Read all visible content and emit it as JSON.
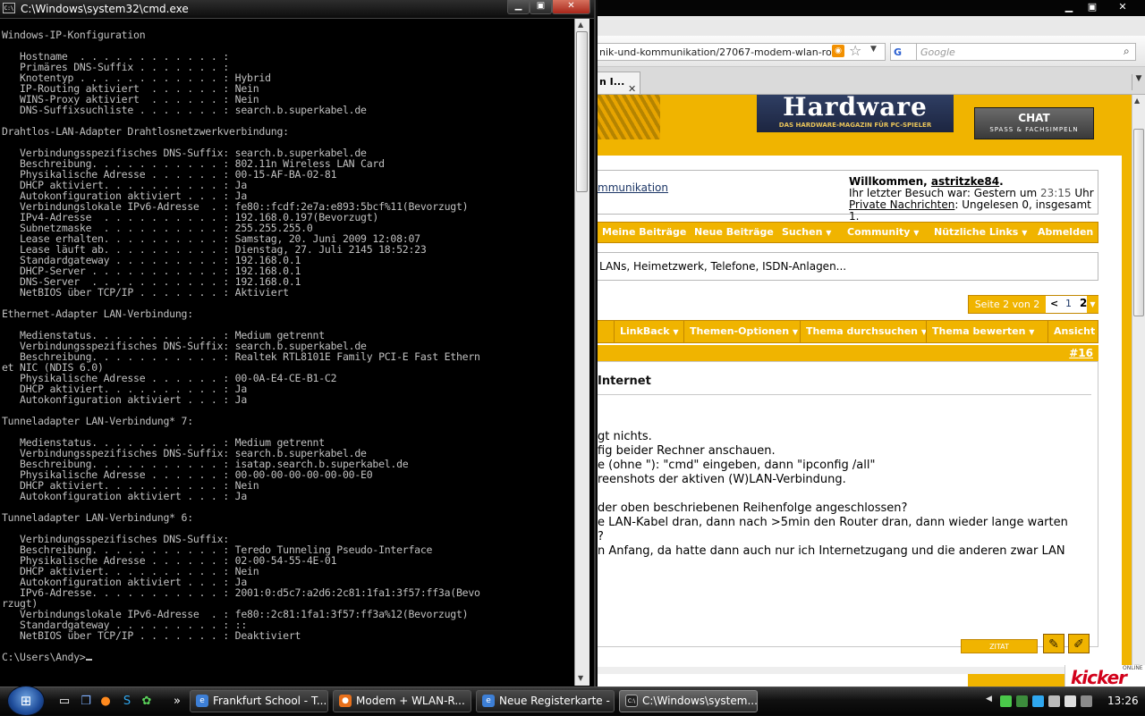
{
  "cmd": {
    "title": "C:\\Windows\\system32\\cmd.exe",
    "icon_text": "C:\\",
    "controls": {
      "minimize": "▁",
      "maximize": "▣",
      "close": "✕"
    },
    "output": [
      "Windows-IP-Konfiguration",
      "",
      "   Hostname  . . . . . . . . . . . . : ",
      "   Primäres DNS-Suffix . . . . . . . : ",
      "   Knotentyp . . . . . . . . . . . . : Hybrid",
      "   IP-Routing aktiviert  . . . . . . : Nein",
      "   WINS-Proxy aktiviert  . . . . . . : Nein",
      "   DNS-Suffixsuchliste . . . . . . . : search.b.superkabel.de",
      "",
      "Drahtlos-LAN-Adapter Drahtlosnetzwerkverbindung:",
      "",
      "   Verbindungsspezifisches DNS-Suffix: search.b.superkabel.de",
      "   Beschreibung. . . . . . . . . . . : 802.11n Wireless LAN Card",
      "   Physikalische Adresse . . . . . . : 00-15-AF-BA-02-81",
      "   DHCP aktiviert. . . . . . . . . . : Ja",
      "   Autokonfiguration aktiviert . . . : Ja",
      "   Verbindungslokale IPv6-Adresse  . : fe80::fcdf:2e7a:e893:5bcf%11(Bevorzugt)",
      "   IPv4-Adresse  . . . . . . . . . . : 192.168.0.197(Bevorzugt)",
      "   Subnetzmaske  . . . . . . . . . . : 255.255.255.0",
      "   Lease erhalten. . . . . . . . . . : Samstag, 20. Juni 2009 12:08:07",
      "   Lease läuft ab. . . . . . . . . . : Dienstag, 27. Juli 2145 18:52:23",
      "   Standardgateway . . . . . . . . . : 192.168.0.1",
      "   DHCP-Server . . . . . . . . . . . : 192.168.0.1",
      "   DNS-Server  . . . . . . . . . . . : 192.168.0.1",
      "   NetBIOS über TCP/IP . . . . . . . : Aktiviert",
      "",
      "Ethernet-Adapter LAN-Verbindung:",
      "",
      "   Medienstatus. . . . . . . . . . . : Medium getrennt",
      "   Verbindungsspezifisches DNS-Suffix: search.b.superkabel.de",
      "   Beschreibung. . . . . . . . . . . : Realtek RTL8101E Family PCI-E Fast Ethern",
      "et NIC (NDIS 6.0)",
      "   Physikalische Adresse . . . . . . : 00-0A-E4-CE-B1-C2",
      "   DHCP aktiviert. . . . . . . . . . : Ja",
      "   Autokonfiguration aktiviert . . . : Ja",
      "",
      "Tunneladapter LAN-Verbindung* 7:",
      "",
      "   Medienstatus. . . . . . . . . . . : Medium getrennt",
      "   Verbindungsspezifisches DNS-Suffix: search.b.superkabel.de",
      "   Beschreibung. . . . . . . . . . . : isatap.search.b.superkabel.de",
      "   Physikalische Adresse . . . . . . : 00-00-00-00-00-00-00-E0",
      "   DHCP aktiviert. . . . . . . . . . : Nein",
      "   Autokonfiguration aktiviert . . . : Ja",
      "",
      "Tunneladapter LAN-Verbindung* 6:",
      "",
      "   Verbindungsspezifisches DNS-Suffix:",
      "   Beschreibung. . . . . . . . . . . : Teredo Tunneling Pseudo-Interface",
      "   Physikalische Adresse . . . . . . : 02-00-54-55-4E-01",
      "   DHCP aktiviert. . . . . . . . . . : Nein",
      "   Autokonfiguration aktiviert . . . : Ja",
      "   IPv6-Adresse. . . . . . . . . . . : 2001:0:d5c7:a2d6:2c81:1fa1:3f57:ff3a(Bevo",
      "rzugt)",
      "   Verbindungslokale IPv6-Adresse  . : fe80::2c81:1fa1:3f57:ff3a%12(Bevorzugt)",
      "   Standardgateway . . . . . . . . . : ::",
      "   NetBIOS über TCP/IP . . . . . . . : Deaktiviert",
      "",
      "C:\\Users\\Andy>"
    ]
  },
  "browser": {
    "controls": {
      "minimize": "▁",
      "maximize": "▣",
      "close": "✕"
    },
    "url": "nik-und-kommunikation/27067-modem-wlan-ro",
    "rss_icon": "rss",
    "search": {
      "engine": "G",
      "placeholder": "Google"
    },
    "tab": {
      "label": "n I...",
      "close": "✕"
    },
    "logo": {
      "title": "Hardware",
      "subtitle": "DAS HARDWARE-MAGAZIN FÜR PC-SPIELER"
    },
    "chat": {
      "label": "CHAT",
      "sub": "SPASS & FACHSIMPELN"
    },
    "breadcrumb": "mmunikation",
    "welcome": {
      "prefix": "Willkommen, ",
      "user": "astritzke84",
      "suffix": ".",
      "last_visit_prefix": "Ihr letzter Besuch war: Gestern um ",
      "last_visit_time": "23:15",
      "last_visit_suffix": " Uhr",
      "pm_link": "Private Nachrichten",
      "pm_status": ": Ungelesen 0, insgesamt 1."
    },
    "nav": [
      "Meine Beiträge",
      "Neue Beiträge",
      "Suchen",
      "Community",
      "Nützliche Links",
      "Abmelden"
    ],
    "forum_desc": "LANs, Heimetzwerk, Telefone, ISDN-Anlagen...",
    "pagination": {
      "label": "Seite 2 von 2",
      "prev": "<",
      "page1": "1",
      "page2": "2"
    },
    "tools": [
      "LinkBack",
      "Themen-Optionen",
      "Thema durchsuchen",
      "Thema bewerten",
      "Ansicht"
    ],
    "post": {
      "number_prefix": "#",
      "number": "16",
      "title": "Internet",
      "lines": [
        "gt nichts.",
        "fig beider Rechner anschauen.",
        "e (ohne \"): \"cmd\" eingeben, dann \"ipconfig /all\"",
        "reenshots der aktiven (W)LAN-Verbindung.",
        "",
        "der oben beschriebenen Reihenfolge angeschlossen?",
        "e LAN-Kabel dran, dann nach >5min den Router dran, dann wieder lange warten",
        "?",
        "n Anfang, da hatte dann auch nur ich Internetzugang und die anderen zwar LAN"
      ],
      "quote_button": "ZITAT"
    },
    "kicker": {
      "brand": "kicker",
      "online": "ONLINE"
    }
  },
  "taskbar": {
    "start": "⊞",
    "quicklaunch_more": "»",
    "tasks": [
      {
        "label": "Frankfurt School - T...",
        "icon": "ie-icon",
        "color": "#3d7fd6"
      },
      {
        "label": "Modem + WLAN-R...",
        "icon": "firefox-icon",
        "color": "#e8701b"
      },
      {
        "label": "Neue Registerkarte - ...",
        "icon": "ie-icon",
        "color": "#3d7fd6"
      },
      {
        "label": "C:\\Windows\\system...",
        "icon": "cmd-icon",
        "color": "#222222"
      }
    ],
    "clock": "13:26"
  }
}
